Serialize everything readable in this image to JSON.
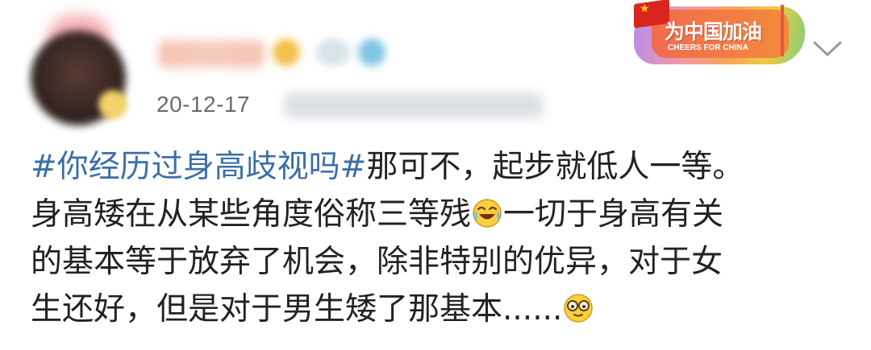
{
  "post": {
    "date": "20-12-17",
    "sticker": {
      "title": "为中国加油",
      "subtitle": "CHEERS FOR CHINA"
    },
    "content": {
      "hashtag": "#你经历过身高歧视吗#",
      "line1_text": "那可不，起步就低人一等。",
      "line2_text": "身高矮在从某些角度俗称三等残",
      "line2_after": "一切于身高有关",
      "line3_text": "的基本等于放弃了机会，除非特别的优异，对于女",
      "line4_text": "生还好，但是对于男生矮了那基本......"
    },
    "icons": {
      "emoji_laugh_cry": "laugh-cry-emoji-icon",
      "emoji_glasses": "nerd-glasses-emoji-icon",
      "collapse": "chevron-down-icon"
    }
  }
}
